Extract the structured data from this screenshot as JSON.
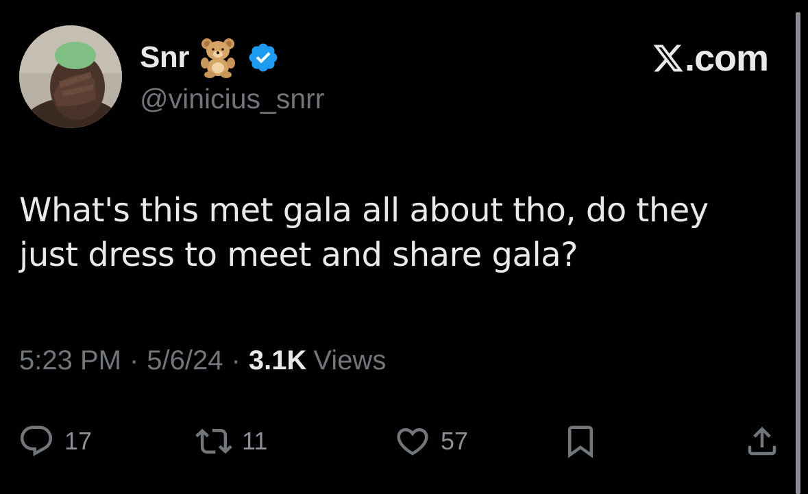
{
  "user": {
    "display_name": "Snr",
    "emoji": "teddy-bear-emoji",
    "verified": true,
    "handle": "@vinicius_snrr"
  },
  "source": {
    "logo": "x-logo-icon",
    "domain": ".com"
  },
  "tweet": {
    "text_line1": "What's this met gala all about tho, do they",
    "text_line2": "just dress to meet and share gala?"
  },
  "meta": {
    "time": "5:23 PM",
    "separator": "·",
    "date": "5/6/24",
    "views_count": "3.1K",
    "views_label": "Views"
  },
  "actions": {
    "reply_count": "17",
    "retweet_count": "11",
    "like_count": "57"
  },
  "colors": {
    "background": "#000000",
    "primary_text": "#e7e9ea",
    "secondary_text": "#71767b",
    "verified_blue": "#1d9bf0"
  }
}
